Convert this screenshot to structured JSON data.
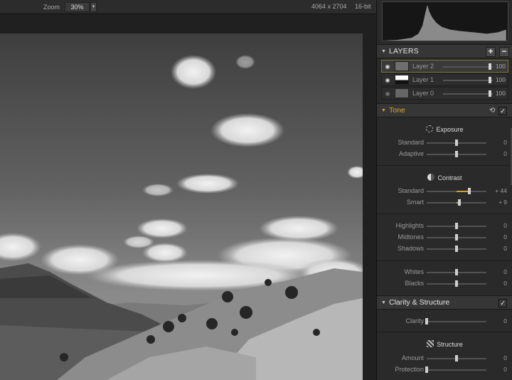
{
  "topbar": {
    "zoom_label": "Zoom",
    "zoom_value": "30%",
    "image_size": "4064 x 2704",
    "bit_depth": "16-bit"
  },
  "layers": {
    "title": "LAYERS",
    "add_label": "+",
    "remove_label": "−",
    "items": [
      {
        "name": "Layer 2",
        "opacity": "100",
        "opacity_fraction": 0.95,
        "selected": true,
        "visible": true
      },
      {
        "name": "Layer 1",
        "opacity": "100",
        "opacity_fraction": 0.95,
        "selected": false,
        "visible": true
      },
      {
        "name": "Layer 0",
        "opacity": "100",
        "opacity_fraction": 0.95,
        "selected": false,
        "visible": false
      }
    ]
  },
  "tone": {
    "title": "Tone",
    "enabled": true,
    "groups": [
      {
        "title": "Exposure",
        "icon": "exposure-icon",
        "sliders": [
          {
            "label": "Standard",
            "value": "0",
            "level": 0
          },
          {
            "label": "Adaptive",
            "value": "0",
            "level": 0
          }
        ]
      },
      {
        "title": "Contrast",
        "icon": "contrast-icon",
        "sliders": [
          {
            "label": "Standard",
            "value": "+ 44",
            "level": 44
          },
          {
            "label": "Smart",
            "value": "+ 9",
            "level": 9
          }
        ]
      },
      {
        "title": "",
        "sliders": [
          {
            "label": "Highlights",
            "value": "0",
            "level": 0
          },
          {
            "label": "Midtones",
            "value": "0",
            "level": 0
          },
          {
            "label": "Shadows",
            "value": "0",
            "level": 0
          }
        ]
      },
      {
        "title": "",
        "sliders": [
          {
            "label": "Whites",
            "value": "0",
            "level": 0
          },
          {
            "label": "Blacks",
            "value": "0",
            "level": 0
          }
        ]
      }
    ]
  },
  "clarity": {
    "title": "Clarity & Structure",
    "enabled": true,
    "clarity_slider": {
      "label": "Clarity",
      "value": "0",
      "level": -100
    },
    "structure_title": "Structure",
    "structure_sliders": [
      {
        "label": "Amount",
        "value": "0",
        "level": 0
      },
      {
        "label": "Protection",
        "value": "0",
        "level": -100
      }
    ]
  },
  "colors": {
    "accent": "#e0a52e",
    "slider_fill": "#c9a238",
    "panel_bg": "#2a2a2a"
  }
}
